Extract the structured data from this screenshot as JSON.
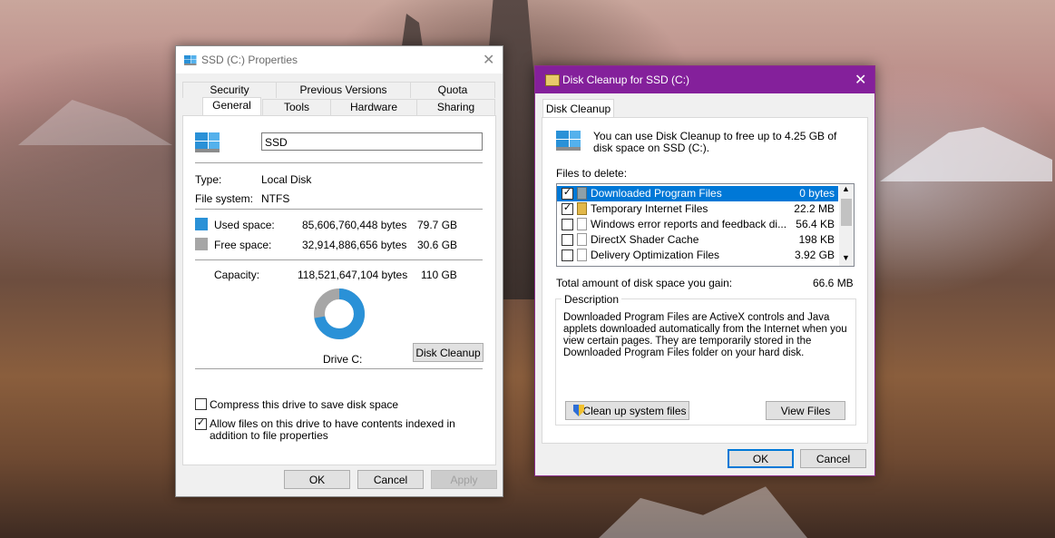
{
  "colors": {
    "used": "#2a91d7",
    "free": "#a6a6a6",
    "cleanup_title": "#84209b",
    "selection": "#0078d7"
  },
  "props": {
    "title": "SSD (C:) Properties",
    "tabs_top": [
      "Security",
      "Previous Versions",
      "Quota"
    ],
    "tabs_bottom": [
      "General",
      "Tools",
      "Hardware",
      "Sharing"
    ],
    "name_value": "SSD",
    "type_label": "Type:",
    "type_value": "Local Disk",
    "fs_label": "File system:",
    "fs_value": "NTFS",
    "used_label": "Used space:",
    "used_bytes": "85,606,760,448 bytes",
    "used_gb": "79.7 GB",
    "free_label": "Free space:",
    "free_bytes": "32,914,886,656 bytes",
    "free_gb": "30.6 GB",
    "capacity_label": "Capacity:",
    "capacity_bytes": "118,521,647,104 bytes",
    "capacity_gb": "110 GB",
    "used_fraction": 0.722,
    "drive_label": "Drive C:",
    "disk_cleanup": "Disk Cleanup",
    "compress_label": "Compress this drive to save disk space",
    "compress_checked": false,
    "index_label": "Allow files on this drive to have contents indexed in addition to file properties",
    "index_checked": true,
    "ok": "OK",
    "cancel": "Cancel",
    "apply": "Apply"
  },
  "cleanup": {
    "title": "Disk Cleanup for SSD (C:)",
    "tab": "Disk Cleanup",
    "intro": "You can use Disk Cleanup to free up to 4.25 GB of disk space on SSD (C:).",
    "files_label": "Files to delete:",
    "files": [
      {
        "name": "Downloaded Program Files",
        "size": "0 bytes",
        "checked": true,
        "selected": true
      },
      {
        "name": "Temporary Internet Files",
        "size": "22.2 MB",
        "checked": true,
        "selected": false
      },
      {
        "name": "Windows error reports and feedback di...",
        "size": "56.4 KB",
        "checked": false,
        "selected": false
      },
      {
        "name": "DirectX Shader Cache",
        "size": "198 KB",
        "checked": false,
        "selected": false
      },
      {
        "name": "Delivery Optimization Files",
        "size": "3.92 GB",
        "checked": false,
        "selected": false
      }
    ],
    "total_label": "Total amount of disk space you gain:",
    "total_value": "66.6 MB",
    "desc_title": "Description",
    "desc_text": "Downloaded Program Files are ActiveX controls and Java applets downloaded automatically from the Internet when you view certain pages. They are temporarily stored in the Downloaded Program Files folder on your hard disk.",
    "cleanup_system": "Clean up system files",
    "view_files": "View Files",
    "ok": "OK",
    "cancel": "Cancel"
  }
}
